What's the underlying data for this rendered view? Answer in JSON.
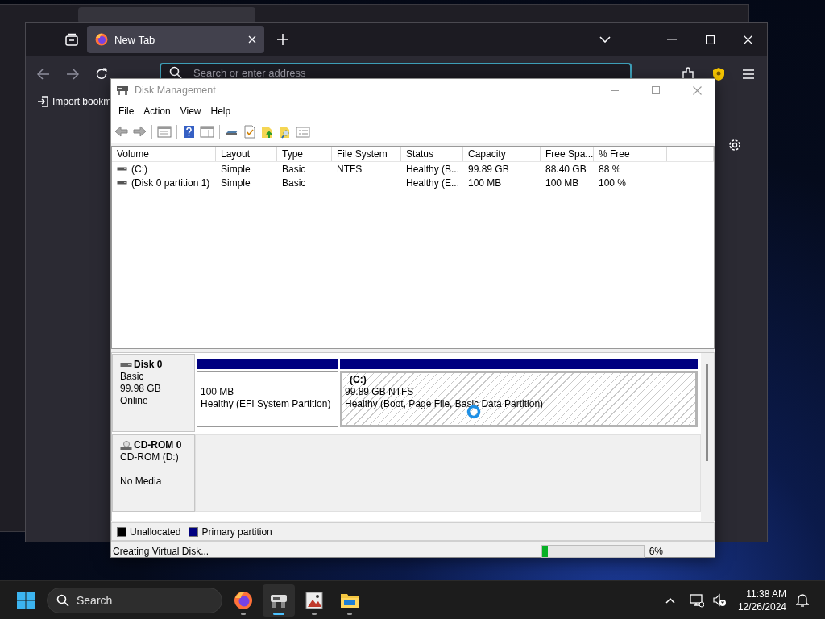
{
  "browser": {
    "tab": {
      "title": "New Tab",
      "selected": true
    },
    "address": {
      "placeholder": "Search or enter address"
    },
    "bookmarks": [
      {
        "label": "Import bookm"
      }
    ]
  },
  "disk_management": {
    "title": "Disk Management",
    "menu": [
      "File",
      "Action",
      "View",
      "Help"
    ],
    "volume_table": {
      "columns": [
        "Volume",
        "Layout",
        "Type",
        "File System",
        "Status",
        "Capacity",
        "Free Spa...",
        "% Free"
      ],
      "rows": [
        {
          "volume": "(C:)",
          "layout": "Simple",
          "type": "Basic",
          "file_system": "NTFS",
          "status": "Healthy (B...",
          "capacity": "99.89 GB",
          "free_space": "88.40 GB",
          "percent_free": "88 %"
        },
        {
          "volume": "(Disk 0 partition 1)",
          "layout": "Simple",
          "type": "Basic",
          "status": "Healthy (E...",
          "capacity": "100 MB",
          "free_space": "100 MB",
          "percent_free": "100 %"
        }
      ]
    },
    "disks": [
      {
        "kind": "disk",
        "name": "Disk 0",
        "details": [
          "Basic",
          "99.98 GB"
        ],
        "status": "Online",
        "partitions": [
          {
            "size": "100 MB",
            "status": "Healthy (EFI System Partition)",
            "selected": false
          },
          {
            "label": "(C:)",
            "size": "99.89 GB NTFS",
            "status": "Healthy (Boot, Page File, Basic Data Partition)",
            "selected": true
          }
        ]
      },
      {
        "kind": "cdrom",
        "name": "CD-ROM 0",
        "details": [
          "CD-ROM (D:)"
        ],
        "status": "No Media"
      }
    ],
    "legend": [
      {
        "label": "Unallocated",
        "color": "#000000"
      },
      {
        "label": "Primary partition",
        "color": "#000080"
      }
    ],
    "status_bar": {
      "text": "Creating Virtual Disk...",
      "level": 0.06,
      "reading": "6%"
    }
  },
  "taskbar": {
    "search": {
      "placeholder": "Search"
    },
    "apps": [
      {
        "kind": "browser",
        "selected": false
      },
      {
        "kind": "disk",
        "selected": true
      },
      {
        "kind": "viewer",
        "selected": false
      },
      {
        "kind": "folder",
        "selected": false
      }
    ],
    "clock": {
      "time": "11:38 AM",
      "date": "12/26/2024"
    }
  }
}
